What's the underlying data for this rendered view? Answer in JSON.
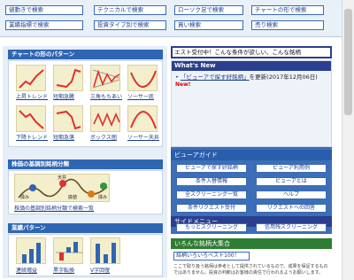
{
  "top_buttons": [
    {
      "label": "値動きで検索"
    },
    {
      "label": "テクニカルで検索"
    },
    {
      "label": "ローソク足で検索"
    },
    {
      "label": "チャートの形で検索"
    },
    {
      "label": "業績指標で検索"
    },
    {
      "label": "投資タイプ別で検索"
    },
    {
      "label": "買い検索"
    },
    {
      "label": "売り検索"
    }
  ],
  "chart_patterns": {
    "title": "チャートの形のパターン",
    "items": [
      {
        "label": "上昇トレンド"
      },
      {
        "label": "短期急騰"
      },
      {
        "label": "三角もちあい"
      },
      {
        "label": "ソーサー底"
      },
      {
        "label": "下降トレンド"
      },
      {
        "label": "短期急落"
      },
      {
        "label": "ボックス圏"
      },
      {
        "label": "ソーサー天井"
      }
    ]
  },
  "price_range": {
    "title": "株価の基調別銘柄分類",
    "caption": "株価の基調別銘柄分類で検索一覧",
    "labels": [
      "揉み",
      "天井",
      "底値",
      "揉み"
    ]
  },
  "business": {
    "title": "業績パターン",
    "items": [
      {
        "label": "連続増益"
      },
      {
        "label": "黒字転換"
      },
      {
        "label": "V字回復"
      }
    ]
  },
  "marquee": {
    "text": "エスト受付中！こんな条件が欲しい、こんな銘柄"
  },
  "news": {
    "title": "What's New",
    "link": "「ビューアで探す好銘柄」",
    "text": "を更新(2017年12月06日)",
    "badge": "New!"
  },
  "viewer_guide": {
    "title": "ビューアガイド",
    "buttons": [
      {
        "label": "ビューアで探す好銘柄"
      },
      {
        "label": "ビューア利用例"
      },
      {
        "label": "条件入替情報"
      },
      {
        "label": "ビューアとは"
      },
      {
        "label": "全スクリーニング一覧"
      },
      {
        "label": "ヘルプ"
      },
      {
        "label": "条件リクエスト受付"
      },
      {
        "label": "リクエストへの回答"
      }
    ]
  },
  "side_menu": {
    "title": "サイドメニュー",
    "buttons": [
      {
        "label": "もっとスクリーニング"
      },
      {
        "label": "信用残スクリーニング"
      }
    ]
  },
  "ranking": {
    "title": "いろんな銘柄大集合",
    "button": "銘柄いろいろベスト100！"
  },
  "disclaimer": "ここで取り扱う銘柄は参考として提供されているもので、成果を保証するものではありません。投資の判断はお客様の責任で行われるようお願いします。",
  "colors": {
    "accent": "#2f66b3",
    "navy": "#2a3f8f",
    "green": "#2e7d32"
  }
}
